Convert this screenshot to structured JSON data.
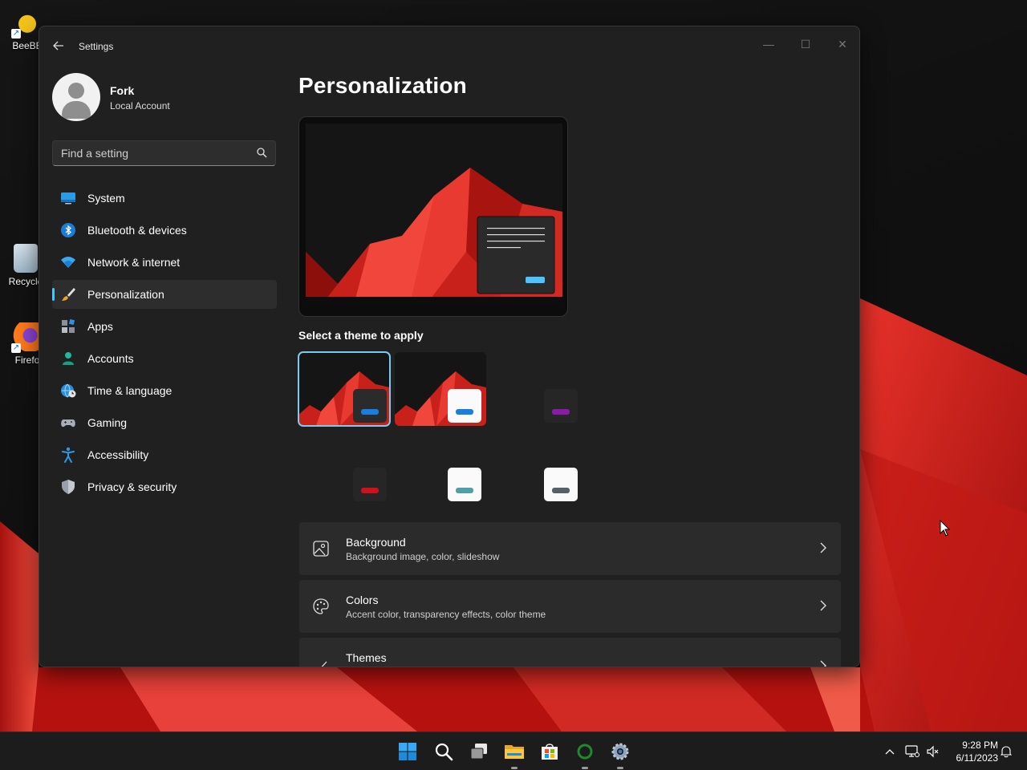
{
  "desktop": {
    "icons": [
      {
        "label": "BeeBE"
      },
      {
        "label": "Recycle"
      },
      {
        "label": "Firefo"
      }
    ]
  },
  "window": {
    "title": "Settings",
    "controls": {
      "minimize": "—",
      "maximize": "☐",
      "close": "✕"
    }
  },
  "user": {
    "name": "Fork",
    "account_type": "Local Account"
  },
  "search": {
    "placeholder": "Find a setting"
  },
  "sidebar": {
    "items": [
      {
        "label": "System",
        "icon": "system-icon"
      },
      {
        "label": "Bluetooth & devices",
        "icon": "bluetooth-icon"
      },
      {
        "label": "Network & internet",
        "icon": "wifi-icon"
      },
      {
        "label": "Personalization",
        "icon": "brush-icon",
        "active": true
      },
      {
        "label": "Apps",
        "icon": "apps-icon"
      },
      {
        "label": "Accounts",
        "icon": "person-icon"
      },
      {
        "label": "Time & language",
        "icon": "globe-clock-icon"
      },
      {
        "label": "Gaming",
        "icon": "gamepad-icon"
      },
      {
        "label": "Accessibility",
        "icon": "accessibility-icon"
      },
      {
        "label": "Privacy & security",
        "icon": "shield-icon"
      }
    ]
  },
  "main": {
    "title": "Personalization",
    "theme_section_label": "Select a theme to apply",
    "themes": [
      {
        "name": "dark-red",
        "selected": true
      },
      {
        "name": "light-red",
        "selected": false
      },
      {
        "name": "purple",
        "selected": false
      },
      {
        "name": "red",
        "selected": false
      },
      {
        "name": "teal-white",
        "selected": false
      },
      {
        "name": "slate-white",
        "selected": false
      }
    ],
    "cards": [
      {
        "title": "Background",
        "desc": "Background image, color, slideshow",
        "icon": "image-icon"
      },
      {
        "title": "Colors",
        "desc": "Accent color, transparency effects, color theme",
        "icon": "palette-icon"
      },
      {
        "title": "Themes",
        "desc": "",
        "icon": "brush-icon"
      }
    ]
  },
  "taskbar": {
    "clock": {
      "time": "9:28 PM",
      "date": "6/11/2023"
    }
  },
  "colors": {
    "accent": "#4cc2ff",
    "window_bg": "#202020",
    "card_bg": "#2b2b2b",
    "wallpaper_red": "#d9211d"
  }
}
